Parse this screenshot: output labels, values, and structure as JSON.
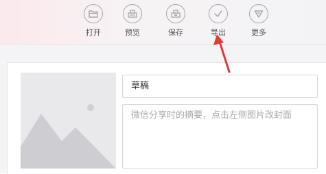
{
  "toolbar": {
    "items": [
      {
        "label": "打开",
        "icon": "folder-icon"
      },
      {
        "label": "预览",
        "icon": "preview-icon"
      },
      {
        "label": "保存",
        "icon": "save-icon"
      },
      {
        "label": "导出",
        "icon": "check-icon"
      },
      {
        "label": "更多",
        "icon": "triangle-down-icon"
      }
    ]
  },
  "editor": {
    "title_value": "草稿",
    "summary_placeholder": "微信分享时的摘要，点击左侧图片改封面"
  },
  "colors": {
    "annotation_arrow": "#e53935",
    "toolbar_icon": "#a5a5a5"
  }
}
